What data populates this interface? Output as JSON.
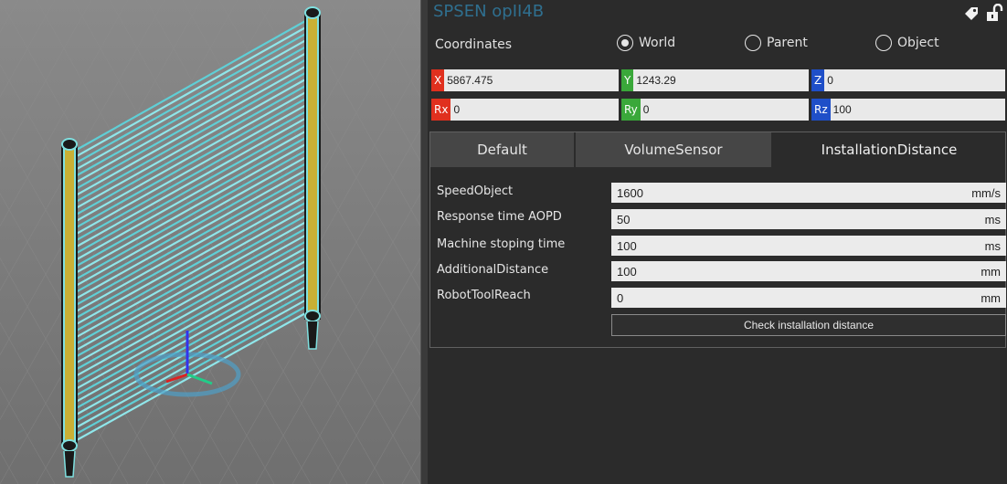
{
  "object_title": "SPSEN opII4B",
  "icons": {
    "tag": "tag-icon",
    "lock": "unlock-icon"
  },
  "coordinates": {
    "label": "Coordinates",
    "options": [
      {
        "label": "World",
        "selected": true
      },
      {
        "label": "Parent",
        "selected": false
      },
      {
        "label": "Object",
        "selected": false
      }
    ]
  },
  "position": {
    "x": {
      "label": "X",
      "value": "5867.475",
      "color": "#e0301e"
    },
    "y": {
      "label": "Y",
      "value": "1243.29",
      "color": "#3aa83a"
    },
    "z": {
      "label": "Z",
      "value": "0",
      "color": "#1f4fc8"
    }
  },
  "rotation": {
    "rx": {
      "label": "Rx",
      "value": "0",
      "color": "#e0301e"
    },
    "ry": {
      "label": "Ry",
      "value": "0",
      "color": "#3aa83a"
    },
    "rz": {
      "label": "Rz",
      "value": "100",
      "color": "#1f4fc8"
    }
  },
  "tabs": [
    {
      "label": "Default",
      "active": false
    },
    {
      "label": "VolumeSensor",
      "active": false
    },
    {
      "label": "InstallationDistance",
      "active": true
    }
  ],
  "properties": [
    {
      "label": "SpeedObject",
      "value": "1600",
      "unit": "mm/s"
    },
    {
      "label": "Response time AOPD",
      "value": "50",
      "unit": "ms"
    },
    {
      "label": "Machine stoping time",
      "value": "100",
      "unit": "ms"
    },
    {
      "label": "AdditionalDistance",
      "value": "100",
      "unit": "mm"
    },
    {
      "label": "RobotToolReach",
      "value": "0",
      "unit": "mm"
    }
  ],
  "check_button": "Check installation distance"
}
